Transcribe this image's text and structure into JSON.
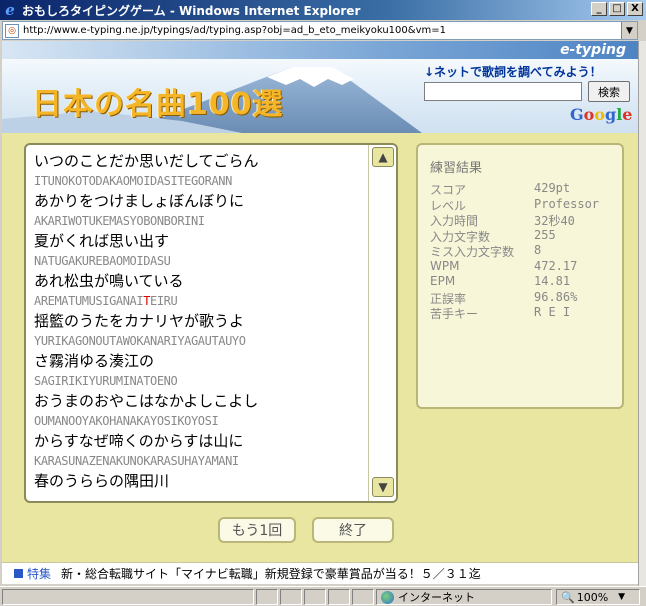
{
  "window": {
    "title": "おもしろタイピングゲーム - Windows Internet Explorer",
    "minimize": "_",
    "maximize": "□",
    "close": "X",
    "address_url": "http://www.e-typing.ne.jp/typings/ad/typing.asp?obj=ad_b_eto_meikyoku100&vm=1"
  },
  "header": {
    "brand": "e-typing",
    "site_title": "日本の名曲100選",
    "lyrics_search_caption": "↓ネットで歌詞を調べてみよう！",
    "search_placeholder": "",
    "search_button": "検索",
    "google": "Google"
  },
  "lyrics": [
    {
      "jp": "いつのことだか思いだしてごらん",
      "romaji": "ITUNOKOTODAKAOMOIDASITEGORANN"
    },
    {
      "jp": "あかりをつけましょぼんぼりに",
      "romaji": "AKARIWOTUKEMASYOBONBORINI"
    },
    {
      "jp": "夏がくれば思い出す",
      "romaji": "NATUGAKUREBAOMOIDASU"
    },
    {
      "jp": "あれ松虫が鳴いている",
      "romaji": "AREMATUMUSIGANAITEIRU"
    },
    {
      "jp": "揺籃のうたをカナリヤが歌うよ",
      "romaji": "YURIKAGONOUTAWOKANARIYAGAUTAUYO"
    },
    {
      "jp": "さ霧消ゆる湊江の",
      "romaji": "SAGIRIKIYURUMINATOENO"
    },
    {
      "jp": "おうまのおやこはなかよしこよし",
      "romaji": "OUMANOOYAKOHANAKAYOSIKOYOSI"
    },
    {
      "jp": "からすなぜ啼くのからすは山に",
      "romaji": "KARASUNAZENAKUNOKARASUHAYAMANI"
    },
    {
      "jp": "春のうららの隅田川",
      "romaji": ""
    }
  ],
  "error_highlight": {
    "line_index": 3,
    "before": "AREMATUMUSIGANAI",
    "char": "T",
    "after": "EIRU"
  },
  "results": {
    "title": "練習結果",
    "rows": [
      {
        "label": "スコア",
        "value": "429pt"
      },
      {
        "label": "レベル",
        "value": "Professor"
      },
      {
        "label": "入力時間",
        "value": "32秒40"
      },
      {
        "label": "入力文字数",
        "value": "255"
      },
      {
        "label": "ミス入力文字数",
        "value": "8"
      },
      {
        "label": "WPM",
        "value": "472.17"
      },
      {
        "label": "EPM",
        "value": "14.81"
      },
      {
        "label": "正誤率",
        "value": "96.86%"
      },
      {
        "label": "苦手キー",
        "value": "R E I"
      }
    ]
  },
  "buttons": {
    "retry": "もう1回",
    "quit": "終了"
  },
  "ticker": {
    "label": "特集",
    "text": "新・総合転職サイト「マイナビ転職」新規登録で豪華賞品が当る！５／３１迄"
  },
  "statusbar": {
    "zone": "インターネット",
    "zoom": "100%"
  },
  "colors": {
    "page_bg": "#e8e6a0",
    "accent": "#003399",
    "title_gold": "#f4b628"
  }
}
